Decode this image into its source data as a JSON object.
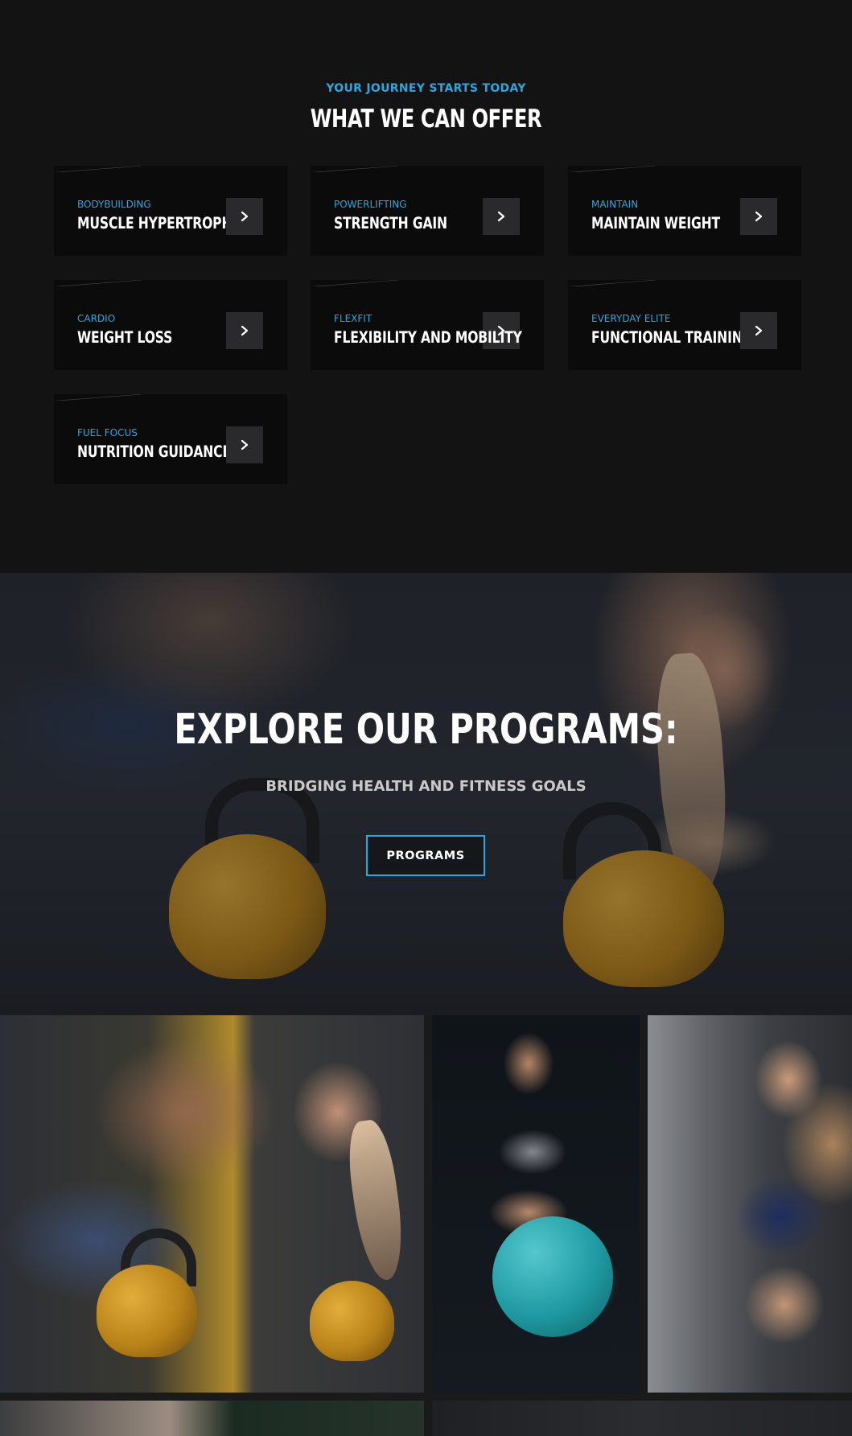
{
  "offer": {
    "eyebrow": "YOUR JOURNEY STARTS TODAY",
    "title": "WHAT WE CAN OFFER",
    "cards": [
      {
        "category": "BODYBUILDING",
        "title": "MUSCLE HYPERTROPHY",
        "arrow_icon": "chevron-right-icon"
      },
      {
        "category": "POWERLIFTING",
        "title": "STRENGTH GAIN",
        "arrow_icon": "chevron-right-icon"
      },
      {
        "category": "MAINTAIN",
        "title": "MAINTAIN WEIGHT",
        "arrow_icon": "chevron-right-icon"
      },
      {
        "category": "CARDIO",
        "title": "WEIGHT LOSS",
        "arrow_icon": "chevron-right-icon"
      },
      {
        "category": "FLEXFIT",
        "title": "FLEXIBILITY AND MOBILITY",
        "arrow_icon": "chevron-right-icon"
      },
      {
        "category": "EVERYDAY ELITE",
        "title": "FUNCTIONAL TRAINING",
        "arrow_icon": "chevron-right-icon"
      },
      {
        "category": "FUEL FOCUS",
        "title": "NUTRITION GUIDANCE",
        "arrow_icon": "chevron-right-icon"
      }
    ]
  },
  "explore": {
    "title": "EXPLORE OUR PROGRAMS:",
    "subtitle": "BRIDGING HEALTH AND FITNESS GOALS",
    "button_label": "PROGRAMS"
  },
  "colors": {
    "background": "#131314",
    "card_background": "#0b0b0c",
    "accent": "#2aa8e0",
    "arrow_button": "#2a2a2c",
    "text": "#ffffff"
  }
}
